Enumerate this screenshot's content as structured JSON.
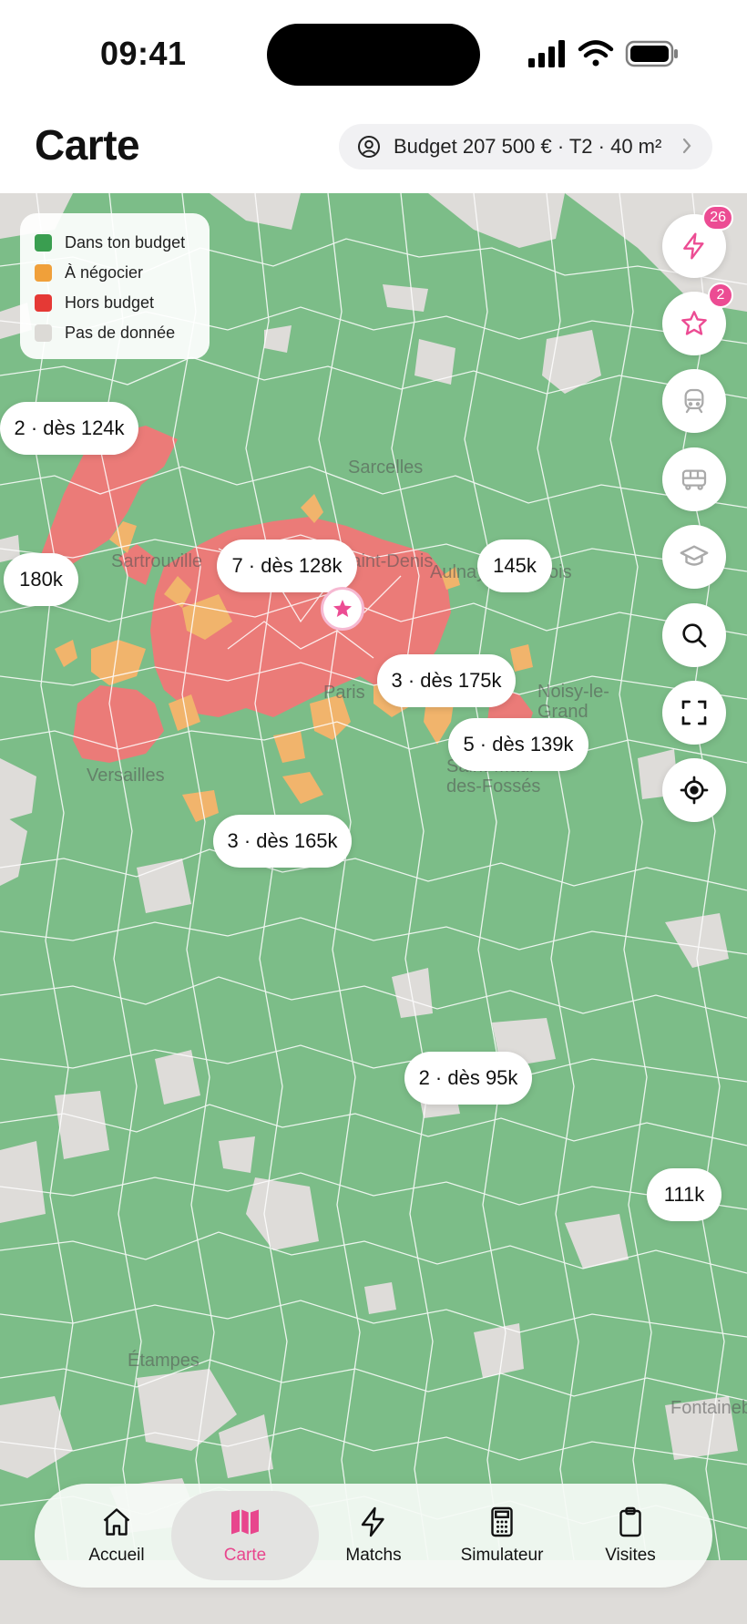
{
  "status_bar": {
    "time": "09:41"
  },
  "header": {
    "title": "Carte",
    "budget_text": "Budget 207 500 € · T2 · 40 m²"
  },
  "legend": {
    "items": [
      {
        "label": "Dans ton budget",
        "color": "#3a9e50"
      },
      {
        "label": "À négocier",
        "color": "#f0a03a"
      },
      {
        "label": "Hors budget",
        "color": "#e53935"
      },
      {
        "label": "Pas de donnée",
        "color": "#dcdad6"
      }
    ]
  },
  "map": {
    "colors": {
      "in_budget": "#7cbd88",
      "negotiate": "#f1b46c",
      "over_budget": "#eb7b78",
      "no_data": "#dedcd9"
    },
    "place_names": [
      "Sarcelles",
      "Sartrouville",
      "Saint-Denis",
      "Aulnay-sous-Bois",
      "Paris",
      "Noisy-le-Grand",
      "Versailles",
      "Saint-Maur-des-Fossés",
      "Étampes",
      "Fontainebleau"
    ],
    "price_labels": [
      "2 · dès 124k",
      "180k",
      "7 · dès 128k",
      "145k",
      "3 · dès 175k",
      "5 · dès 139k",
      "3 · dès 165k",
      "2 · dès 95k",
      "111k"
    ]
  },
  "fabs": [
    {
      "icon": "lightning-icon",
      "badge": "26"
    },
    {
      "icon": "star-icon",
      "badge": "2"
    },
    {
      "icon": "train-icon"
    },
    {
      "icon": "bus-icon"
    },
    {
      "icon": "graduation-cap-icon"
    },
    {
      "icon": "search-icon"
    },
    {
      "icon": "fullscreen-icon"
    },
    {
      "icon": "locate-icon"
    }
  ],
  "nav": {
    "items": [
      {
        "label": "Accueil",
        "icon": "home-icon"
      },
      {
        "label": "Carte",
        "icon": "map-icon",
        "active": true
      },
      {
        "label": "Matchs",
        "icon": "lightning-icon"
      },
      {
        "label": "Simulateur",
        "icon": "calculator-icon"
      },
      {
        "label": "Visites",
        "icon": "clipboard-icon"
      }
    ],
    "accent": "#e8468d"
  }
}
